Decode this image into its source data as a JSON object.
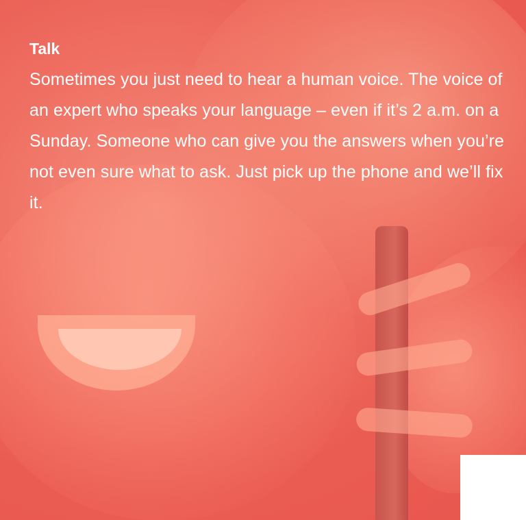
{
  "card": {
    "title": "Talk",
    "body": "Sometimes you just need to hear a human voice. The voice of an expert who speaks your language – even if it’s 2 a.m. on a Sunday. Someone who can give you the answers when you’re not even sure what to ask. Just pick up the phone and we’ll fix it.",
    "overlay_color": "#ee6a5e",
    "text_color": "#ffffff"
  },
  "background_image": {
    "icon": "smiling-woman-on-phone-photo"
  }
}
